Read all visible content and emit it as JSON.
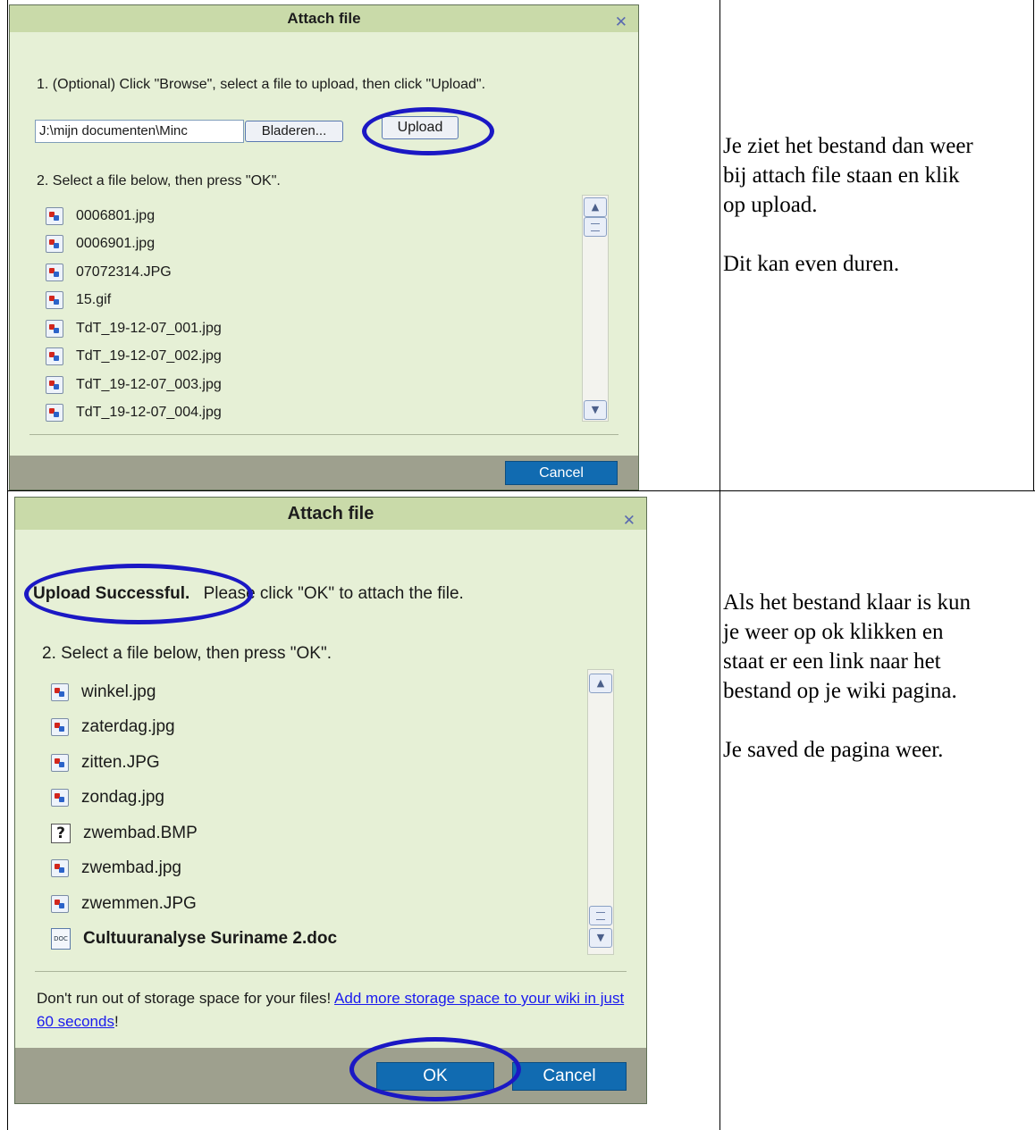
{
  "dialog1": {
    "title": "Attach file",
    "close_glyph": "✕",
    "instruction1": "1. (Optional) Click \"Browse\", select a file to upload, then click \"Upload\".",
    "path_value": "J:\\mijn documenten\\Minc",
    "browse_label": "Bladeren...",
    "upload_label": "Upload",
    "instruction2": "2. Select a file below, then press \"OK\".",
    "files": [
      "0006801.jpg",
      "0006901.jpg",
      "07072314.JPG",
      "15.gif",
      "TdT_19-12-07_001.jpg",
      "TdT_19-12-07_002.jpg",
      "TdT_19-12-07_003.jpg",
      "TdT_19-12-07_004.jpg"
    ],
    "cancel_label": "Cancel"
  },
  "note1": {
    "p1": "Je ziet het bestand dan weer\nbij attach file staan en klik\nop upload.",
    "p2": "Dit kan even duren."
  },
  "dialog2": {
    "title": "Attach file",
    "close_glyph": "✕",
    "upload_status": "Upload Successful.",
    "upload_msg": "Please click \"OK\" to attach the file.",
    "instruction2": "2. Select a file below, then press \"OK\".",
    "files": [
      {
        "name": "winkel.jpg",
        "icon": "image-file-icon"
      },
      {
        "name": "zaterdag.jpg",
        "icon": "image-file-icon"
      },
      {
        "name": "zitten.JPG",
        "icon": "image-file-icon"
      },
      {
        "name": "zondag.jpg",
        "icon": "image-file-icon"
      },
      {
        "name": "zwembad.BMP",
        "icon": "unknown-file-icon"
      },
      {
        "name": "zwembad.jpg",
        "icon": "image-file-icon"
      },
      {
        "name": "zwemmen.JPG",
        "icon": "image-file-icon"
      },
      {
        "name": "Cultuuranalyse Suriname 2.doc",
        "icon": "doc-file-icon"
      }
    ],
    "storage_text": "Don't run out of storage space for your files! ",
    "storage_link_line1": "Add more storage space to",
    "storage_link_line2": "your wiki in just 60 seconds",
    "storage_end": "!",
    "ok_label": "OK",
    "cancel_label": "Cancel"
  },
  "note2": {
    "p1": "Als het bestand klaar is kun\nje weer op ok klikken en\nstaat er een link naar het\nbestand op je wiki pagina.",
    "p2": "Je saved de pagina weer."
  }
}
